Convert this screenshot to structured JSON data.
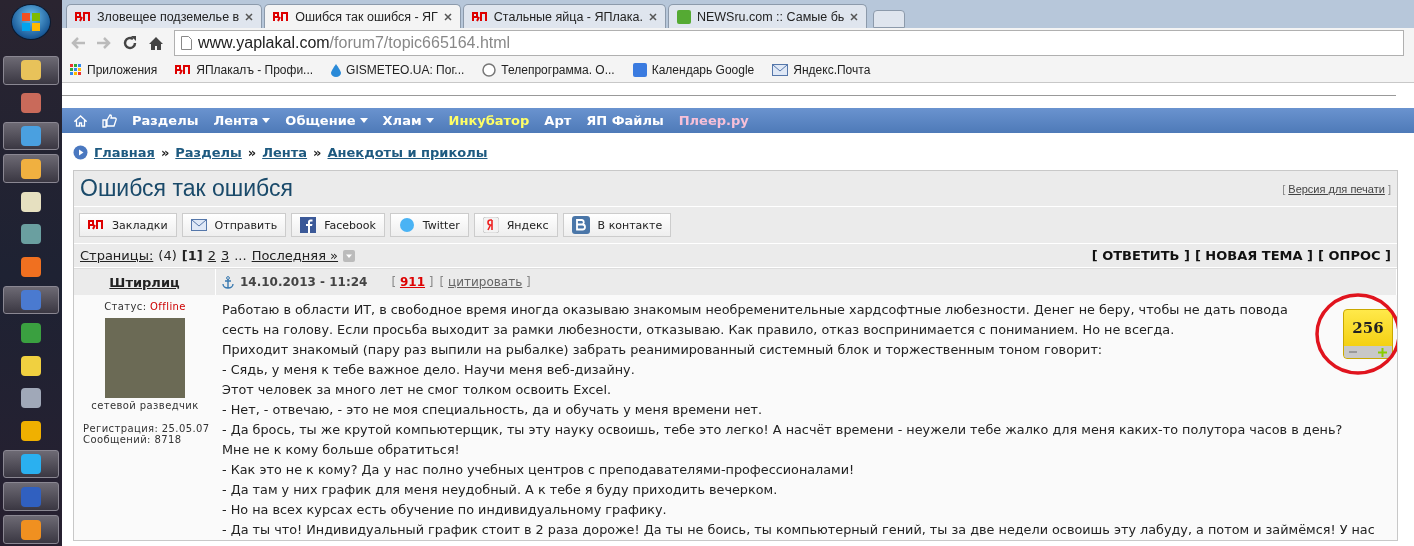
{
  "taskbar": {
    "items": [
      {
        "running": true
      },
      {
        "running": false
      },
      {
        "running": true
      },
      {
        "running": true
      },
      {
        "running": false
      },
      {
        "running": false
      },
      {
        "running": false
      },
      {
        "running": true
      },
      {
        "running": false
      },
      {
        "running": false
      },
      {
        "running": false
      },
      {
        "running": false
      },
      {
        "running": true
      },
      {
        "running": true
      },
      {
        "running": true
      }
    ]
  },
  "browser": {
    "tabs": [
      {
        "title": "Зловещее подземелье в",
        "selected": false,
        "kind": "yap"
      },
      {
        "title": "Ошибся так ошибся - ЯГ",
        "selected": true,
        "kind": "yap"
      },
      {
        "title": "Стальные яйца - ЯПлака.",
        "selected": false,
        "kind": "yap"
      },
      {
        "title": "NEWSru.com :: Самые бь",
        "selected": false,
        "kind": "news"
      }
    ],
    "address": {
      "host": "www.yaplakal.com",
      "path": "/forum7/topic665164.html"
    },
    "bookmarks": [
      {
        "label": "Приложения",
        "kind": "apps"
      },
      {
        "label": "ЯПлакалъ - Профи...",
        "kind": "yap"
      },
      {
        "label": "GISMETEO.UA: Пог...",
        "kind": "drop"
      },
      {
        "label": "Телепрограмма. О...",
        "kind": "tv"
      },
      {
        "label": "Календарь Google",
        "kind": "calendar"
      },
      {
        "label": "Яндекс.Почта",
        "kind": "mail"
      }
    ]
  },
  "nav": [
    {
      "label": "Разделы",
      "dropdown": false,
      "color": "#ffffff"
    },
    {
      "label": "Лента",
      "dropdown": true,
      "color": "#ffffff"
    },
    {
      "label": "Общение",
      "dropdown": true,
      "color": "#ffffff"
    },
    {
      "label": "Хлам",
      "dropdown": true,
      "color": "#ffffff"
    },
    {
      "label": "Инкубатор",
      "dropdown": false,
      "color": "#ffff66"
    },
    {
      "label": "Арт",
      "dropdown": false,
      "color": "#ffffff"
    },
    {
      "label": "ЯП Файлы",
      "dropdown": false,
      "color": "#ffffff"
    },
    {
      "label": "Плеер.ру",
      "dropdown": false,
      "color": "#f7c0d8"
    }
  ],
  "breadcrumbs": [
    "Главная",
    "Разделы",
    "Лента",
    "Анекдоты и приколы"
  ],
  "breadcrumb_separator": "»",
  "topic": {
    "title": "Ошибся так ошибся",
    "print": {
      "open": "[",
      "label": "Версия для печати",
      "close": "]"
    }
  },
  "share": [
    {
      "label": "Закладки",
      "kind": "yap"
    },
    {
      "label": "Отправить",
      "kind": "mail"
    },
    {
      "label": "Facebook",
      "kind": "facebook"
    },
    {
      "label": "Twitter",
      "kind": "twitter"
    },
    {
      "label": "Яндекс",
      "kind": "yandex"
    },
    {
      "label": "В контакте",
      "kind": "vk"
    }
  ],
  "pages": {
    "label": "Страницы:",
    "count": "(4)",
    "items": [
      {
        "label": "[1]",
        "selected": true
      },
      {
        "label": "2",
        "selected": false
      },
      {
        "label": "3",
        "selected": false
      }
    ],
    "ellipsis": "...",
    "last": "Последняя »"
  },
  "actions": [
    "[ ОТВЕТИТЬ ]",
    "[ НОВАЯ ТЕМА ]",
    "[ ОПРОС ]"
  ],
  "post": {
    "author": "Штирлиц",
    "date": "14.10.2013 - 11:24",
    "links": [
      {
        "open": "[",
        "label": "911",
        "close": "]",
        "kind": "rating"
      },
      {
        "open": "[",
        "label": "цитировать",
        "close": "]",
        "kind": "quote"
      }
    ],
    "status_label": "Статус:",
    "status": "Offline",
    "rank": "сетевой разведчик",
    "registration": "Регистрация: 25.05.07",
    "messages": "Сообщений: 8718",
    "rating": "256",
    "lines": [
      "Работаю в области ИТ, в свободное время иногда оказываю знакомым необременительные хардсофтные любезности. Денег не беру, чтобы не дать повода",
      "сесть на голову. Если просьба выходит за рамки любезности, отказываю. Как правило, отказ воспринимается с пониманием. Но не всегда.",
      "Приходит знакомый (пару раз выпили на рыбалке) забрать реанимированный системный блок и торжественным тоном говорит:",
      "- Сядь, у меня к тебе важное дело. Научи меня веб-дизайну.",
      "Этот человек за много лет не смог толком освоить Excel.",
      "- Нет, - отвечаю, - это не моя специальность, да и обучать у меня времени нет.",
      "- Да брось, ты же крутой компьютерщик, ты эту науку освоишь, тебе это легко! А насчёт времени - неужели тебе жалко для меня каких-то полутора часов в день?",
      "Мне не к кому больше обратиться!",
      "- Как это не к кому? Да у нас полно учебных центров с преподавателями-профессионалами!",
      "- Да там у них график для меня неудобный. А к тебе я буду приходить вечерком.",
      "- Но на всех курсах есть обучение по индивидуальному графику.",
      "- Да ты что! Индивидуальный график стоит в 2 раза дороже! Да ты не боись, ты компьютерный гений, ты за две недели освоишь эту лабуду, а потом и займёмся! У нас"
    ]
  }
}
